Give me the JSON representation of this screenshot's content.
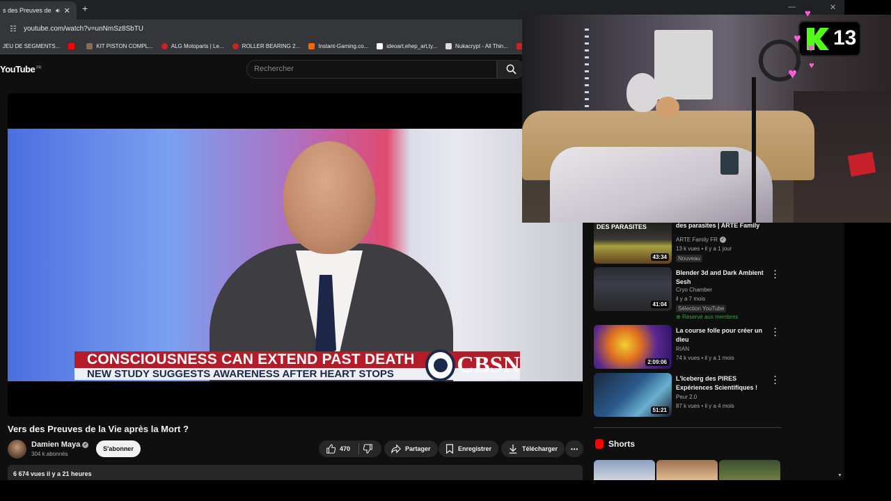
{
  "browser": {
    "tab_title": "s des Preuves de la V",
    "url": "youtube.com/watch?v=unNmSz8SbTU",
    "bookmarks": [
      {
        "label": "JEU DE SEGMENTS...",
        "color": "#555555"
      },
      {
        "label": "",
        "color": "#ff0000"
      },
      {
        "label": "KIT PISTON COMPL...",
        "color": "#8a6a50"
      },
      {
        "label": "ALG Motoparts | Le...",
        "color": "#cc2222"
      },
      {
        "label": "ROLLER BEARING 2...",
        "color": "#cc2222"
      },
      {
        "label": "Instant-Gaming.co...",
        "color": "#ff6600"
      },
      {
        "label": "ideoart,ehep_art,ty...",
        "color": "#ffffff"
      },
      {
        "label": "Nukacrypt - All Thin...",
        "color": "#dddddd"
      },
      {
        "label": "",
        "color": "#cc2222"
      }
    ]
  },
  "header": {
    "logo": "YouTube",
    "logo_country": "FR",
    "search_placeholder": "Rechercher"
  },
  "video": {
    "lower_third_top": "CONSCIOUSNESS CAN EXTEND PAST DEATH",
    "lower_third_bottom": "NEW STUDY SUGGESTS AWARENESS AFTER HEART STOPS",
    "network": "CBSN",
    "title": "Vers des Preuves de la Vie après la Mort ?",
    "channel": "Damien Maya",
    "subscribers": "304 k abonnés",
    "subscribe_label": "S'abonner",
    "likes": "470",
    "share_label": "Partager",
    "save_label": "Enregistrer",
    "download_label": "Télécharger",
    "views_line": "6 674 vues  il y a 21 heures"
  },
  "sidebar": {
    "recommendations": [
      {
        "thumb_text": "DES PARASITES",
        "title": "des parasites | ARTE Family",
        "channel": "ARTE Family FR",
        "verified": true,
        "meta": "13 k vues • il y a 1 jour",
        "badge": "Nouveau",
        "members": "",
        "duration": "43:34"
      },
      {
        "thumb_text": "",
        "title": "Blender 3d and Dark Ambient Sesh",
        "channel": "Cryo Chamber",
        "verified": false,
        "meta": "il y a 7 mois",
        "badge": "Sélection YouTube",
        "members": "Réservé aux membres",
        "duration": "41:04"
      },
      {
        "thumb_text": "",
        "title": "La course folle pour créer un dieu",
        "channel": "RIAN",
        "verified": false,
        "meta": "74 k vues • il y a 1 mois",
        "badge": "",
        "members": "",
        "duration": "2:09:06"
      },
      {
        "thumb_text": "",
        "title": "L'Iceberg des PIRES Expériences Scientifiques !",
        "channel": "Peur 2.0",
        "verified": false,
        "meta": "87 k vues • il y a 4 mois",
        "badge": "",
        "members": "",
        "duration": "51:21"
      }
    ],
    "shorts_label": "Shorts"
  },
  "overlay": {
    "viewer_count": "13",
    "accent": "#53fc18"
  }
}
